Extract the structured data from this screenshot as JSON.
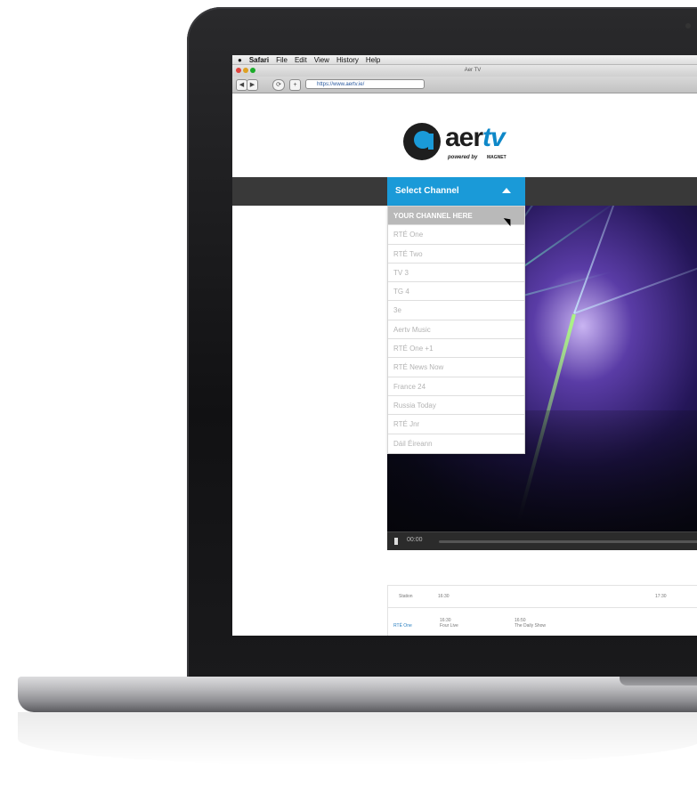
{
  "menubar": {
    "apple": "",
    "app": "Safari",
    "items": [
      "File",
      "Edit",
      "View",
      "History",
      "Help"
    ]
  },
  "window": {
    "title": "Aer TV",
    "url": "https://www.aertv.ie/"
  },
  "logo": {
    "word_main": "aer",
    "word_accent": "tv",
    "powered_by": "powered by",
    "magnet": "MAGNET"
  },
  "channel_select": {
    "label": "Select Channel",
    "options": [
      "YOUR CHANNEL HERE",
      "RTÉ One",
      "RTÉ Two",
      "TV 3",
      "TG 4",
      "3e",
      "Aertv Music",
      "RTÉ One +1",
      "RTÉ News Now",
      "France 24",
      "Russia Today",
      "RTÉ Jnr",
      "Dáil Éireann"
    ],
    "highlighted": "YOUR CHANNEL HERE"
  },
  "player": {
    "time": "00:00"
  },
  "schedule": {
    "station_header": "Station",
    "times": [
      "16:30",
      "17:30"
    ],
    "row_channel": "RTÉ One",
    "programmes": [
      {
        "time": "16:30",
        "title": "Four Live"
      },
      {
        "time": "16:50",
        "title": "The Daily Show"
      }
    ]
  },
  "colors": {
    "accent": "#1a9ad8",
    "navbar": "#393939",
    "highlight_row": "#b9b9b9"
  }
}
